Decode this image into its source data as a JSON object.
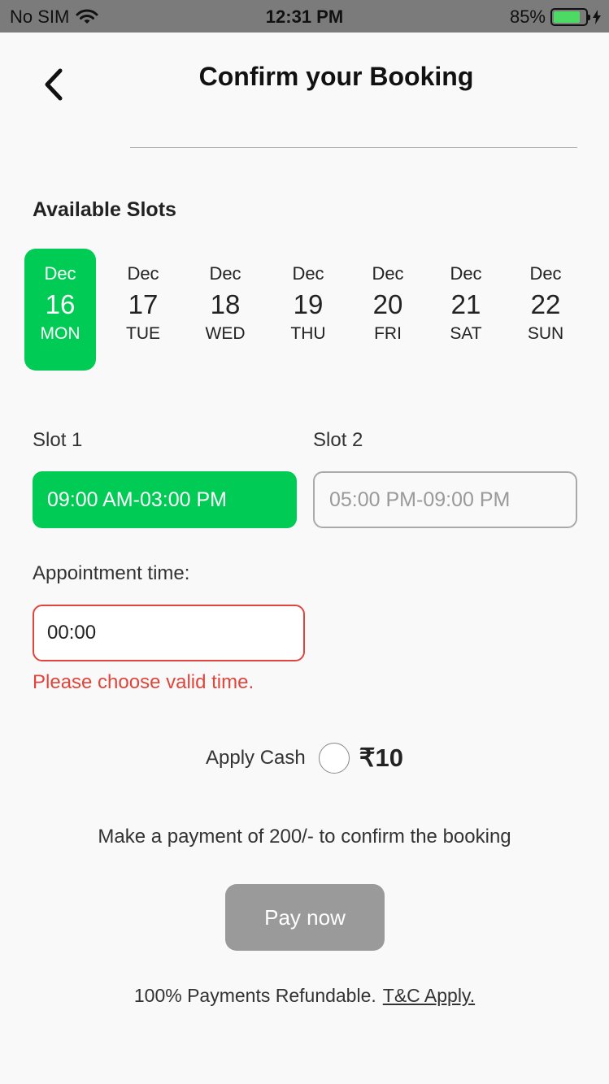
{
  "status_bar": {
    "carrier": "No SIM",
    "time": "12:31 PM",
    "battery": "85%",
    "battery_level": 0.85
  },
  "header": {
    "title": "Confirm your Booking",
    "back_icon": "chevron-left-icon"
  },
  "slots_section": {
    "title": "Available Slots"
  },
  "dates": [
    {
      "month": "Dec",
      "day": "16",
      "weekday": "MON",
      "selected": true
    },
    {
      "month": "Dec",
      "day": "17",
      "weekday": "TUE",
      "selected": false
    },
    {
      "month": "Dec",
      "day": "18",
      "weekday": "WED",
      "selected": false
    },
    {
      "month": "Dec",
      "day": "19",
      "weekday": "THU",
      "selected": false
    },
    {
      "month": "Dec",
      "day": "20",
      "weekday": "FRI",
      "selected": false
    },
    {
      "month": "Dec",
      "day": "21",
      "weekday": "SAT",
      "selected": false
    },
    {
      "month": "Dec",
      "day": "22",
      "weekday": "SUN",
      "selected": false
    }
  ],
  "slots": [
    {
      "label": "Slot 1",
      "time": "09:00 AM-03:00 PM",
      "selected": true
    },
    {
      "label": "Slot 2",
      "time": "05:00 PM-09:00 PM",
      "selected": false
    }
  ],
  "appointment": {
    "label": "Appointment time:",
    "value": "00:00",
    "error": "Please choose valid time."
  },
  "cash": {
    "label": "Apply Cash",
    "amount": "₹10"
  },
  "payment": {
    "text": "Make a payment of  200/- to confirm the booking",
    "button": "Pay now"
  },
  "footer": {
    "text": "100% Payments Refundable.",
    "link": "T&C Apply."
  },
  "colors": {
    "accent": "#00cc55",
    "error": "#e0443a",
    "disabled": "#9a9a9a"
  }
}
